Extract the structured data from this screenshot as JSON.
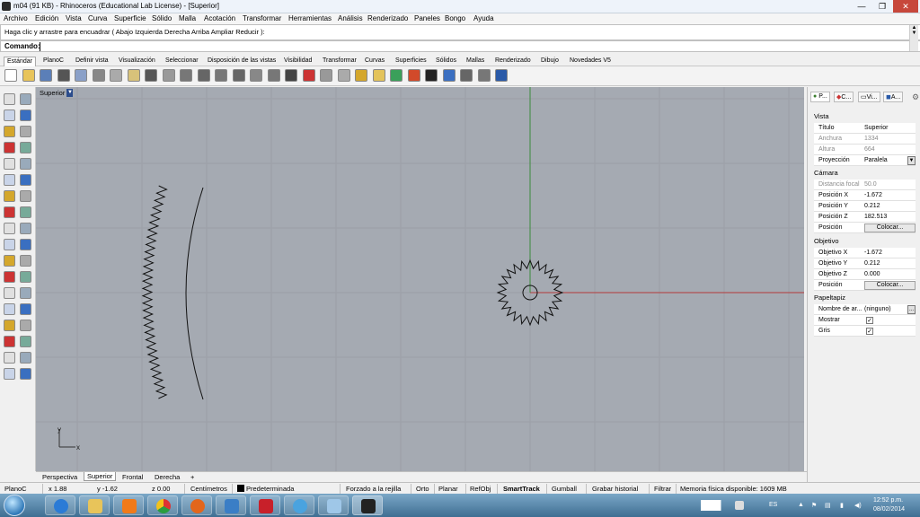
{
  "window": {
    "title": "m04 (91 KB) - Rhinoceros (Educational Lab License) - [Superior]",
    "minimize": "—",
    "maximize": "❐",
    "close": "✕"
  },
  "menu": [
    "Archivo",
    "Edición",
    "Vista",
    "Curva",
    "Superficie",
    "Sólido",
    "Malla",
    "Acotación",
    "Transformar",
    "Herramientas",
    "Análisis",
    "Renderizado",
    "Paneles",
    "Bongo",
    "Ayuda"
  ],
  "command": {
    "history": "Haga clic y arrastre para encuadrar ( Abajo  Izquierda  Derecha  Arriba  Ampliar  Reducir ):",
    "prompt": "Comando:"
  },
  "toolbar_tabs": [
    "Estándar",
    "PlanoC",
    "Definir vista",
    "Visualización",
    "Seleccionar",
    "Disposición de las vistas",
    "Visibilidad",
    "Transformar",
    "Curvas",
    "Superficies",
    "Sólidos",
    "Mallas",
    "Renderizado",
    "Dibujo",
    "Novedades V5"
  ],
  "toolbar_icons": [
    "new-icon",
    "open-icon",
    "save-icon",
    "print-icon",
    "import-icon",
    "cut-icon",
    "copy-icon",
    "paste-icon",
    "undo-icon",
    "pan-icon",
    "rotate-view-icon",
    "zoom-icon",
    "zoom-window-icon",
    "zoom-extents-icon",
    "zoom-selected-icon",
    "zoom-all-icon",
    "grid-icon",
    "car-icon",
    "eye-icon",
    "lock-icon",
    "layer-icon",
    "light-icon",
    "color-icon",
    "material-icon",
    "render-icon",
    "sphere-icon",
    "display-icon",
    "options-icon",
    "help-icon"
  ],
  "viewport": {
    "name": "Superior",
    "tabs": [
      "Perspectiva",
      "Superior",
      "Frontal",
      "Derecha"
    ],
    "add_tab": "+",
    "axis_x": "x",
    "axis_y": "y",
    "background": "#a5aab2",
    "grid_color": "#9b9fa7",
    "x_axis_color": "#b33a3a",
    "y_axis_color": "#3c8a3c"
  },
  "properties_panel": {
    "tabs": [
      "P...",
      "C...",
      "Vi...",
      "A..."
    ],
    "sections": {
      "vista": {
        "label": "Vista",
        "titulo_k": "Título",
        "titulo_v": "Superior",
        "anchura_k": "Anchura",
        "anchura_v": "1334",
        "altura_k": "Altura",
        "altura_v": "664",
        "proyeccion_k": "Proyección",
        "proyeccion_v": "Paralela"
      },
      "camara": {
        "label": "Cámara",
        "distancia_k": "Distancia focal",
        "distancia_v": "50.0",
        "px_k": "Posición X",
        "px_v": "-1.672",
        "py_k": "Posición Y",
        "py_v": "0.212",
        "pz_k": "Posición Z",
        "pz_v": "182.513",
        "pos_k": "Posición",
        "pos_btn": "Colocar..."
      },
      "objetivo": {
        "label": "Objetivo",
        "ox_k": "Objetivo X",
        "ox_v": "-1.672",
        "oy_k": "Objetivo Y",
        "oy_v": "0.212",
        "oz_k": "Objetivo Z",
        "oz_v": "0.000",
        "pos_k": "Posición",
        "pos_btn": "Colocar..."
      },
      "papeltapiz": {
        "label": "Papeltapiz",
        "nombre_k": "Nombre de ar...",
        "nombre_v": "(ninguno)",
        "nombre_btn": "...",
        "mostrar_k": "Mostrar",
        "mostrar_v": "✓",
        "gris_k": "Gris",
        "gris_v": "✓"
      }
    }
  },
  "status": {
    "planoc": "PlanoC",
    "x": "x 1.88",
    "y": "y -1.62",
    "z": "z 0.00",
    "units": "Centímetros",
    "layer": "Predeterminada",
    "snap": "Forzado a la rejilla",
    "orto": "Orto",
    "planar": "Planar",
    "refobj": "RefObj",
    "smarttrack": "SmartTrack",
    "gumball": "Gumball",
    "history": "Grabar historial",
    "filter": "Filtrar",
    "memory": "Memoria física disponible: 1609 MB"
  },
  "taskbar": {
    "lang": "ES",
    "time": "12:52 p.m.",
    "date": "08/02/2014"
  }
}
